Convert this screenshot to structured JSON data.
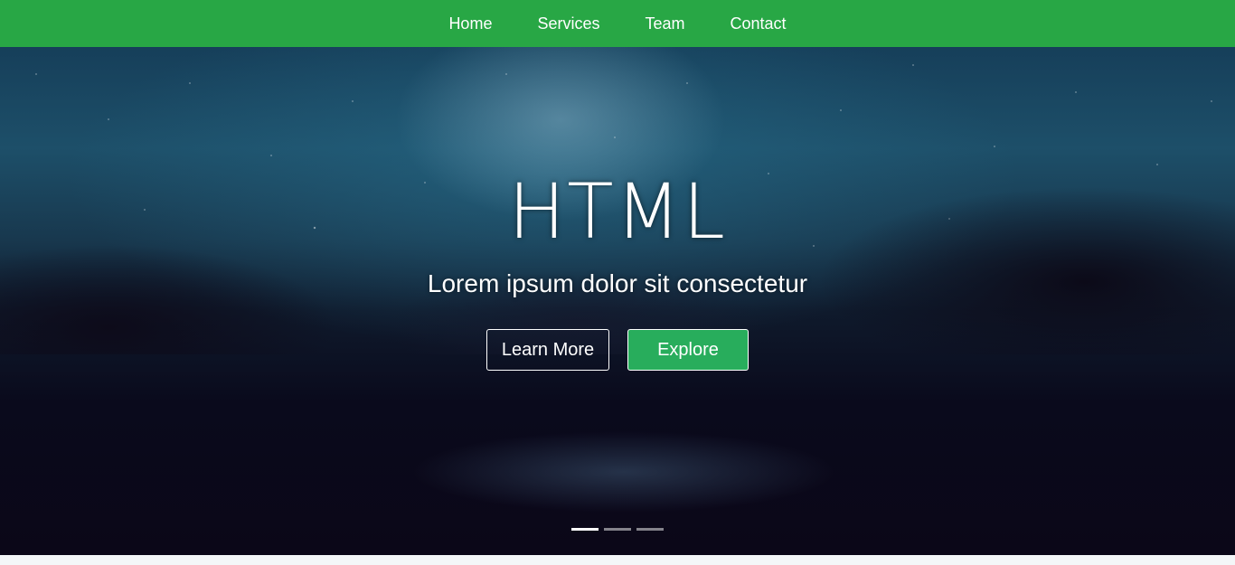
{
  "nav": {
    "items": [
      {
        "label": "Home"
      },
      {
        "label": "Services"
      },
      {
        "label": "Team"
      },
      {
        "label": "Contact"
      }
    ],
    "bg_color": "#28a745"
  },
  "hero": {
    "title": "HTML",
    "subtitle": "Lorem ipsum dolor sit consectetur",
    "buttons": {
      "learn_more": "Learn More",
      "explore": "Explore"
    },
    "explore_color": "#28ad5c",
    "carousel": {
      "slide_count": 3,
      "active_index": 0
    }
  }
}
